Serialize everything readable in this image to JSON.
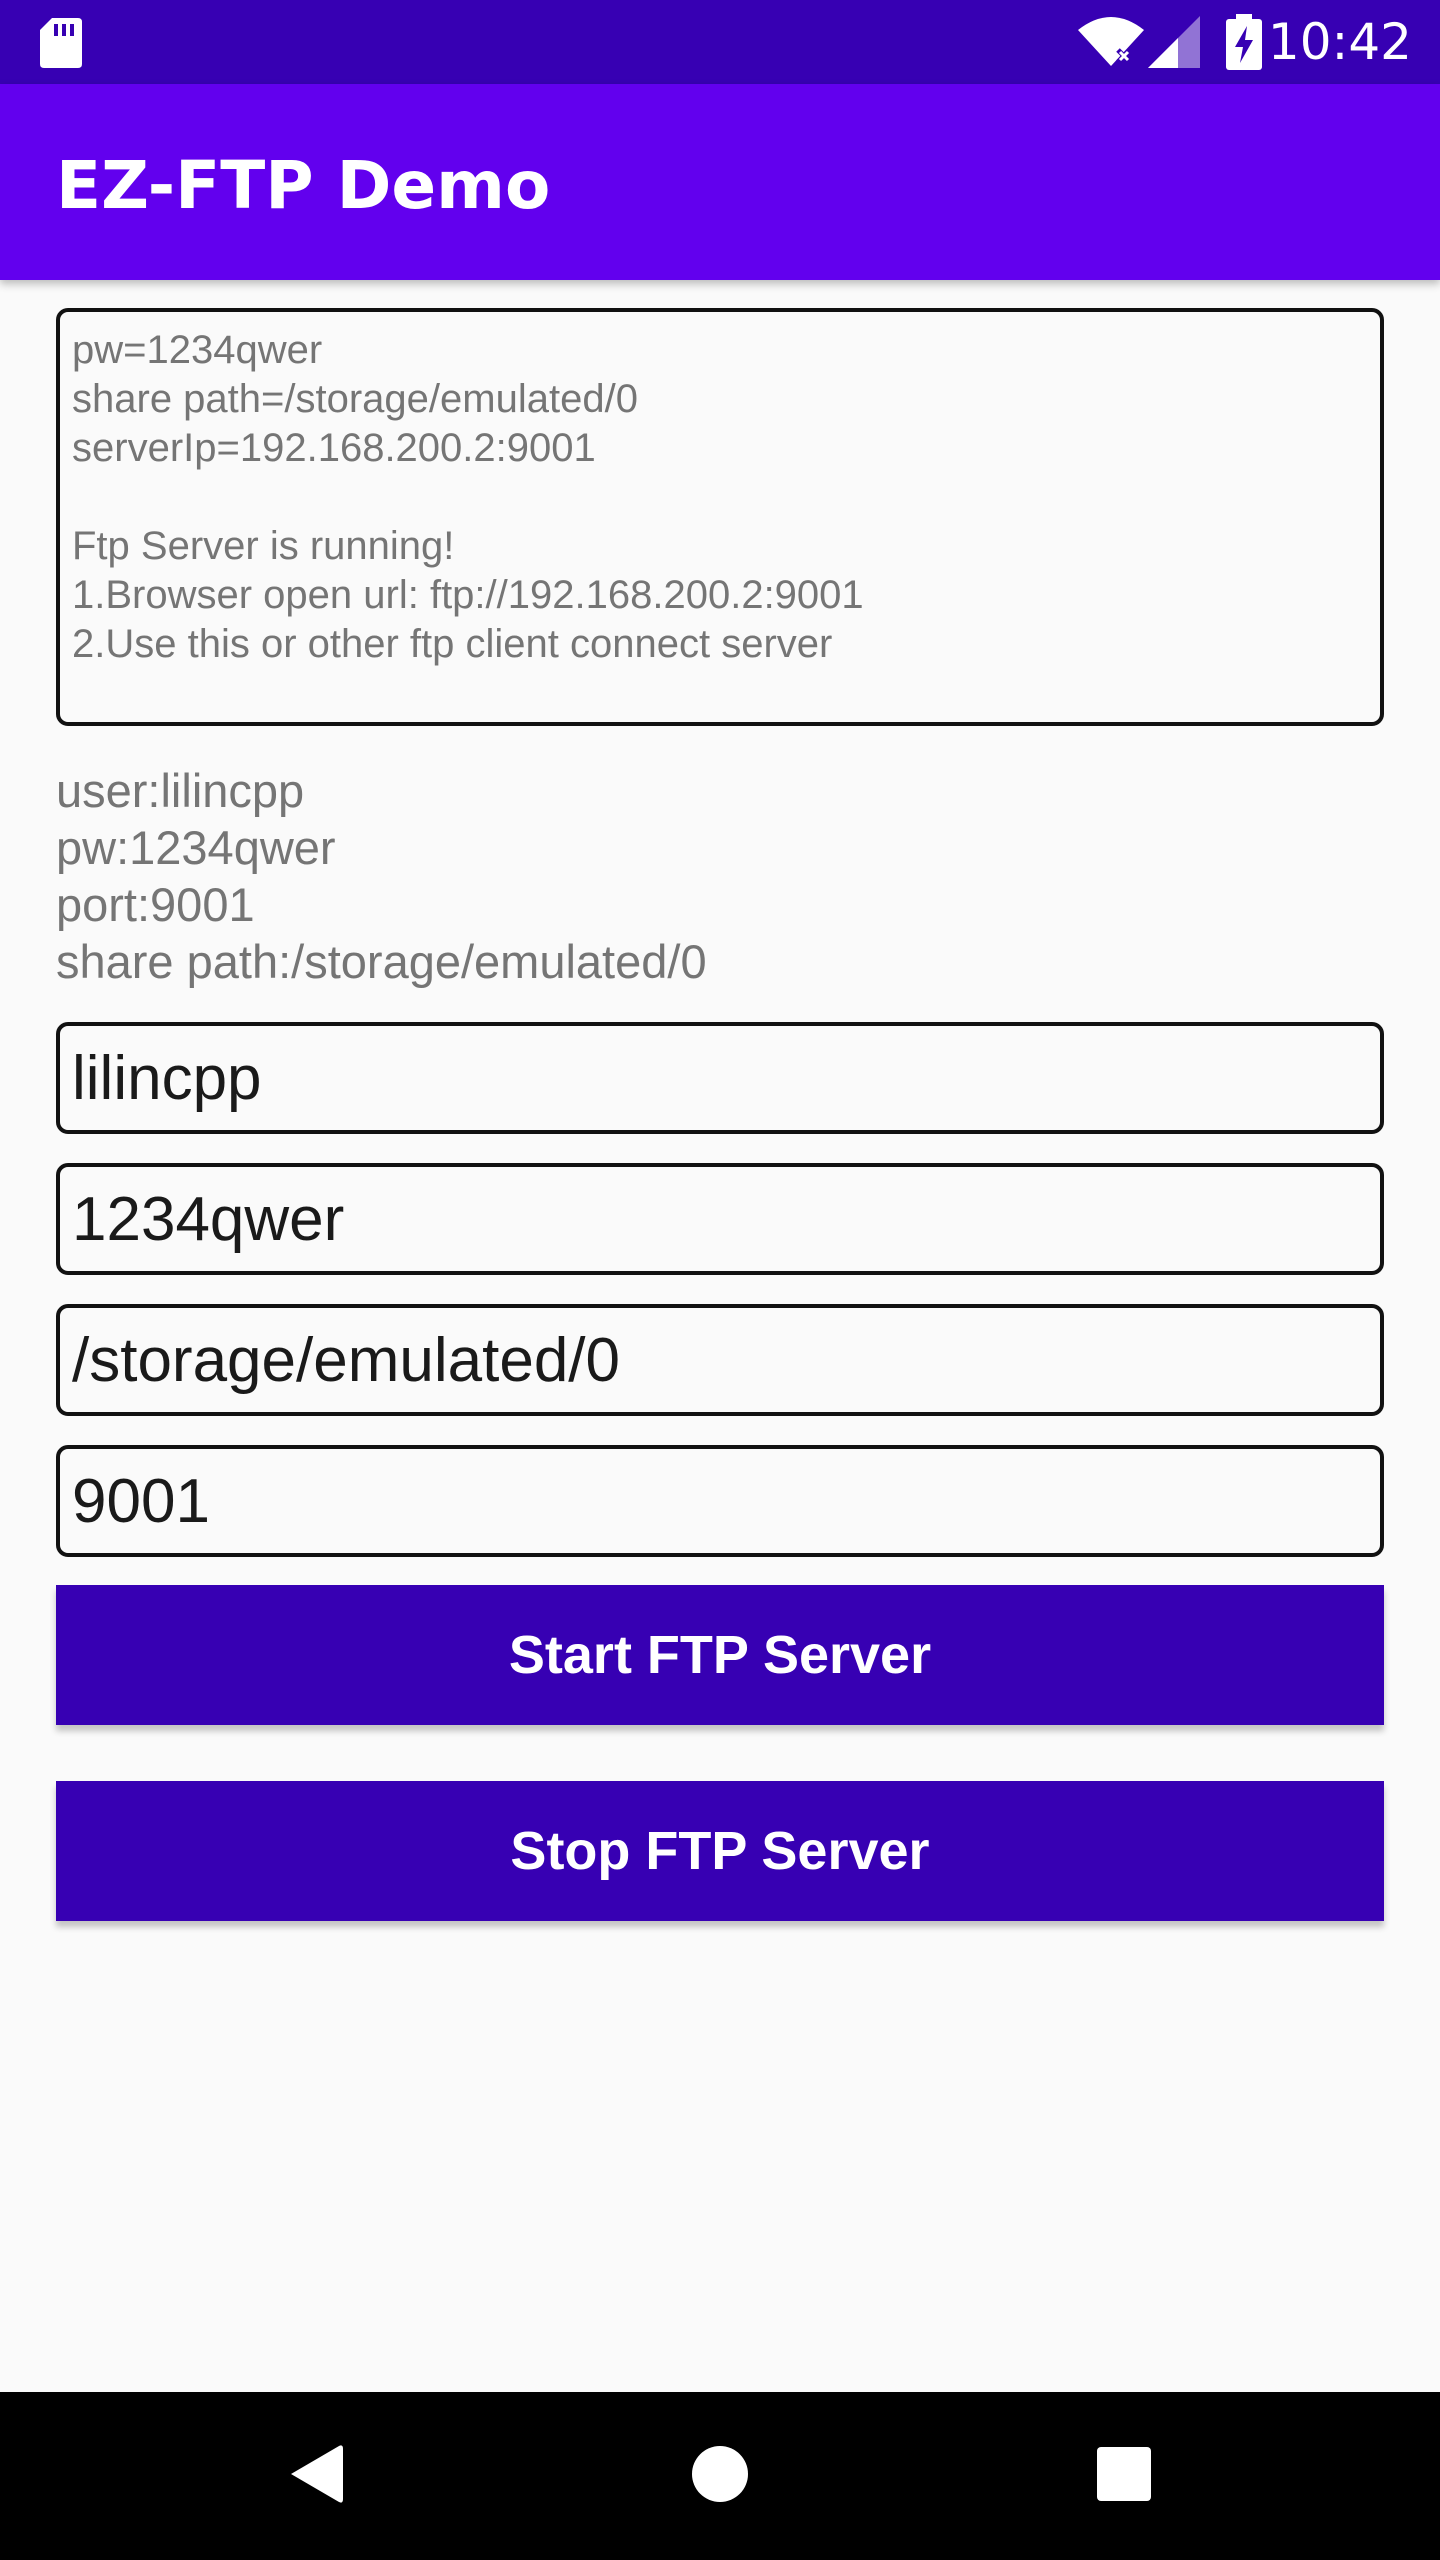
{
  "status_bar": {
    "time": "10:42",
    "icons": [
      "sd-card-icon",
      "wifi-icon",
      "signal-icon",
      "battery-charging-icon"
    ]
  },
  "app_bar": {
    "title": "EZ-FTP Demo"
  },
  "log": {
    "lines": [
      "pw=1234qwer",
      "share path=/storage/emulated/0",
      "serverIp=192.168.200.2:9001",
      "",
      "Ftp Server is running!",
      "1.Browser open url: ftp://192.168.200.2:9001",
      "2.Use this or other ftp client connect server"
    ]
  },
  "info": {
    "user": "user:lilincpp",
    "pw": "pw:1234qwer",
    "port": "port:9001",
    "share_path": "share path:/storage/emulated/0"
  },
  "fields": {
    "user": "lilincpp",
    "password": "1234qwer",
    "path": "/storage/emulated/0",
    "port": "9001"
  },
  "buttons": {
    "start": "Start FTP Server",
    "stop": "Stop FTP Server"
  },
  "nav": {
    "icons": [
      "back-icon",
      "home-icon",
      "recents-icon"
    ]
  },
  "colors": {
    "status_bar": "#3700b3",
    "app_bar": "#6200ee",
    "button": "#3700b3",
    "background": "#fafafa"
  }
}
